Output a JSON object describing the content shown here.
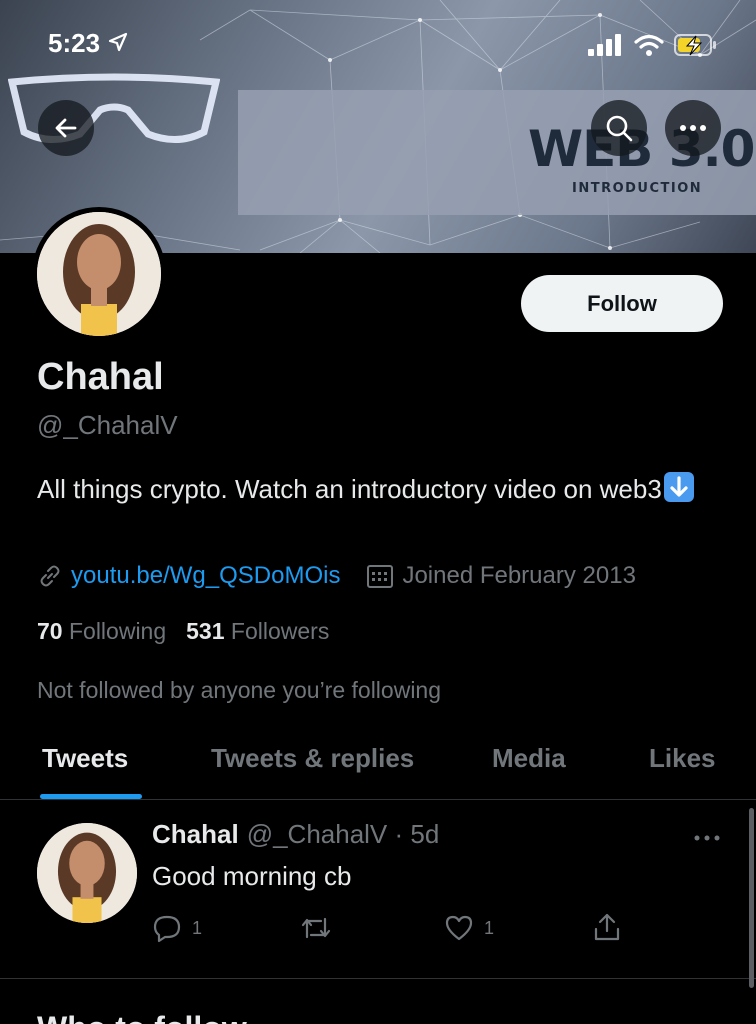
{
  "status_bar": {
    "time": "5:23"
  },
  "banner": {
    "title": "WEB 3.0",
    "subtitle": "INTRODUCTION"
  },
  "profile": {
    "name": "Chahal",
    "handle": "@_ChahalV",
    "bio": "All things crypto. Watch an introductory video on web3",
    "link": "youtu.be/Wg_QSDoMOis",
    "joined": "Joined February 2013",
    "following_count": "70",
    "following_label": "Following",
    "followers_count": "531",
    "followers_label": "Followers",
    "not_followed": "Not followed by anyone you’re following",
    "follow_button": "Follow"
  },
  "tabs": [
    {
      "label": "Tweets",
      "active": true
    },
    {
      "label": "Tweets & replies",
      "active": false
    },
    {
      "label": "Media",
      "active": false
    },
    {
      "label": "Likes",
      "active": false
    }
  ],
  "tweet": {
    "name": "Chahal",
    "handle": "@_ChahalV · 5d",
    "text": "Good morning cb",
    "replies": "1",
    "likes": "1"
  },
  "next_section": {
    "heading": "Who to follow"
  },
  "colors": {
    "accent": "#1d9bf0",
    "background": "#000000",
    "muted": "#71767b"
  },
  "icons": [
    "back-arrow-icon",
    "search-icon",
    "more-icon",
    "link-icon",
    "calendar-icon",
    "reply-icon",
    "retweet-icon",
    "like-icon",
    "share-icon",
    "down-arrow-emoji-icon"
  ]
}
